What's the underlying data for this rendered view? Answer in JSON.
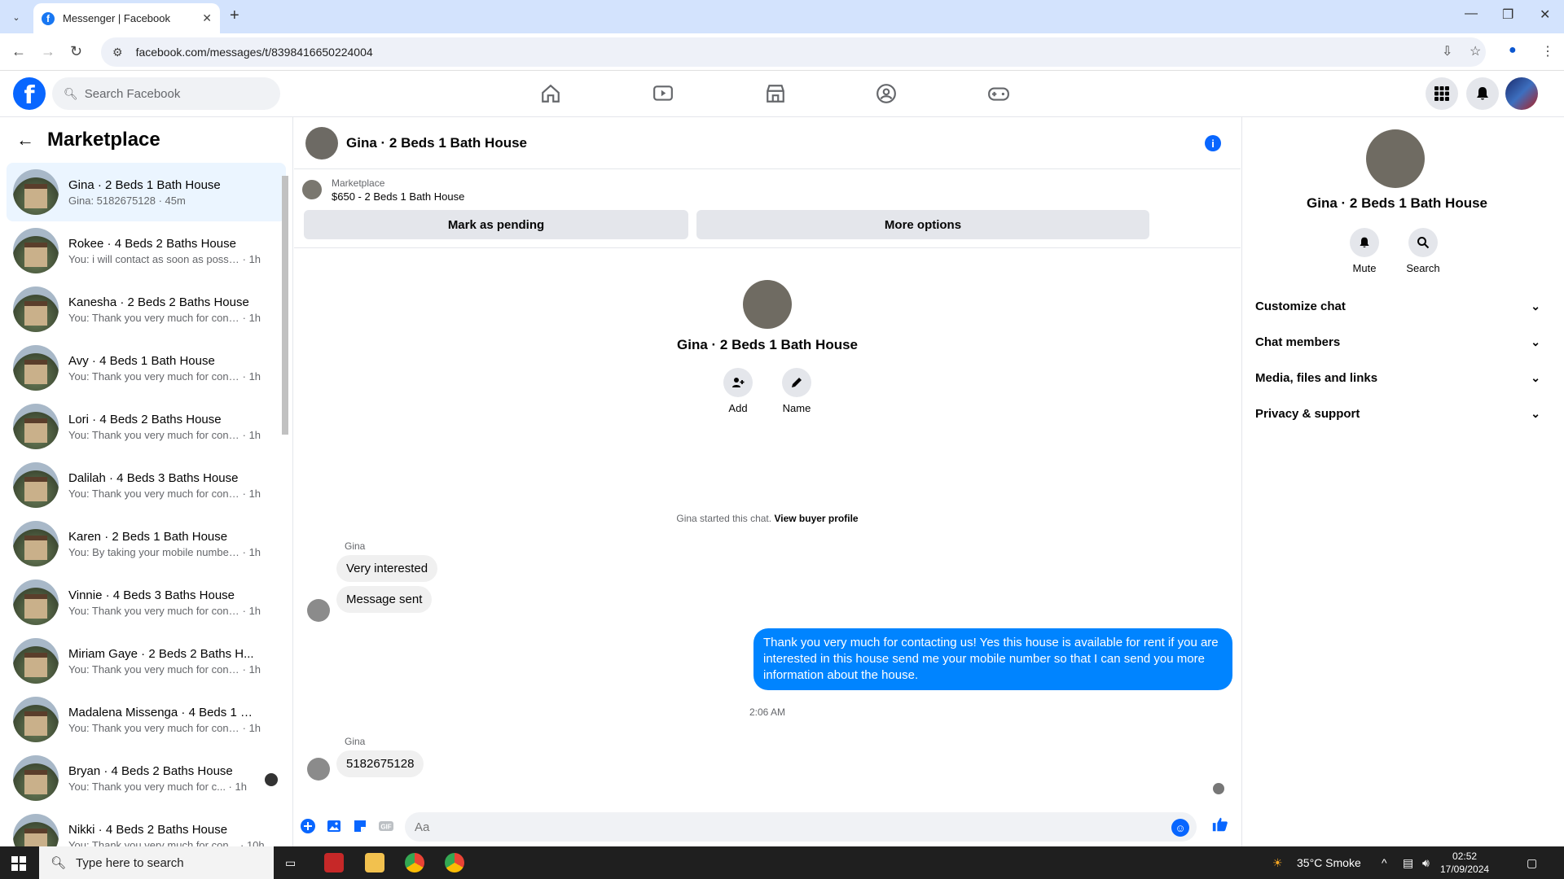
{
  "browser": {
    "tab_title": "Messenger | Facebook",
    "url": "facebook.com/messages/t/8398416650224004"
  },
  "fb": {
    "search_placeholder": "Search Facebook"
  },
  "left": {
    "title": "Marketplace",
    "conversations": [
      {
        "name": "Gina · 2 Beds 1 Bath House",
        "preview": "Gina: 5182675128",
        "time": "45m"
      },
      {
        "name": "Rokee · 4 Beds 2 Baths House",
        "preview": "You: i will contact as soon as possi...",
        "time": "1h"
      },
      {
        "name": "Kanesha · 2 Beds 2 Baths House",
        "preview": "You: Thank you very much for cont...",
        "time": "1h"
      },
      {
        "name": "Avy · 4 Beds 1 Bath House",
        "preview": "You: Thank you very much for cont...",
        "time": "1h"
      },
      {
        "name": "Lori · 4 Beds 2 Baths House",
        "preview": "You: Thank you very much for cont...",
        "time": "1h"
      },
      {
        "name": "Dalilah · 4 Beds 3 Baths House",
        "preview": "You: Thank you very much for cont...",
        "time": "1h"
      },
      {
        "name": "Karen · 2 Beds 1 Bath House",
        "preview": "You: By taking your mobile number...",
        "time": "1h"
      },
      {
        "name": "Vinnie · 4 Beds 3 Baths House",
        "preview": "You: Thank you very much for cont...",
        "time": "1h"
      },
      {
        "name": "Miriam Gaye · 2 Beds 2 Baths H...",
        "preview": "You: Thank you very much for cont...",
        "time": "1h"
      },
      {
        "name": "Madalena Missenga · 4 Beds 1 B...",
        "preview": "You: Thank you very much for cont...",
        "time": "1h"
      },
      {
        "name": "Bryan · 4 Beds 2 Baths House",
        "preview": "You: Thank you very much for c...",
        "time": "1h"
      },
      {
        "name": "Nikki · 4 Beds 2 Baths House",
        "preview": "You: Thank you very much for con...",
        "time": "10h"
      }
    ]
  },
  "chat": {
    "title": "Gina · 2 Beds 1 Bath House",
    "marketplace_label": "Marketplace",
    "listing": "$650 - 2 Beds 1 Bath House",
    "mark_pending": "Mark as pending",
    "more_options": "More options",
    "profile_name": "Gina · 2 Beds 1 Bath House",
    "add_label": "Add",
    "name_label": "Name",
    "started_text": "Gina started this chat.",
    "view_buyer": "View buyer profile",
    "sender1": "Gina",
    "msg1": "Very interested",
    "msg2": "Message sent",
    "msg_out": "Thank you very much for contacting us! Yes this house is available for rent if you are interested in this house send me your mobile number so that I can send you more information about the house.",
    "timestamp": "2:06 AM",
    "sender2": "Gina",
    "msg3": "5182675128",
    "composer_placeholder": "Aa"
  },
  "right": {
    "name": "Gina · 2 Beds 1 Bath House",
    "mute": "Mute",
    "search": "Search",
    "sections": [
      "Customize chat",
      "Chat members",
      "Media, files and links",
      "Privacy & support"
    ]
  },
  "taskbar": {
    "search_placeholder": "Type here to search",
    "weather": "35°C  Smoke",
    "time": "02:52",
    "date": "17/09/2024"
  },
  "colors": {
    "brand": "#0866ff",
    "outgoing_bubble": "#0084ff",
    "active_row": "#ebf5ff"
  }
}
